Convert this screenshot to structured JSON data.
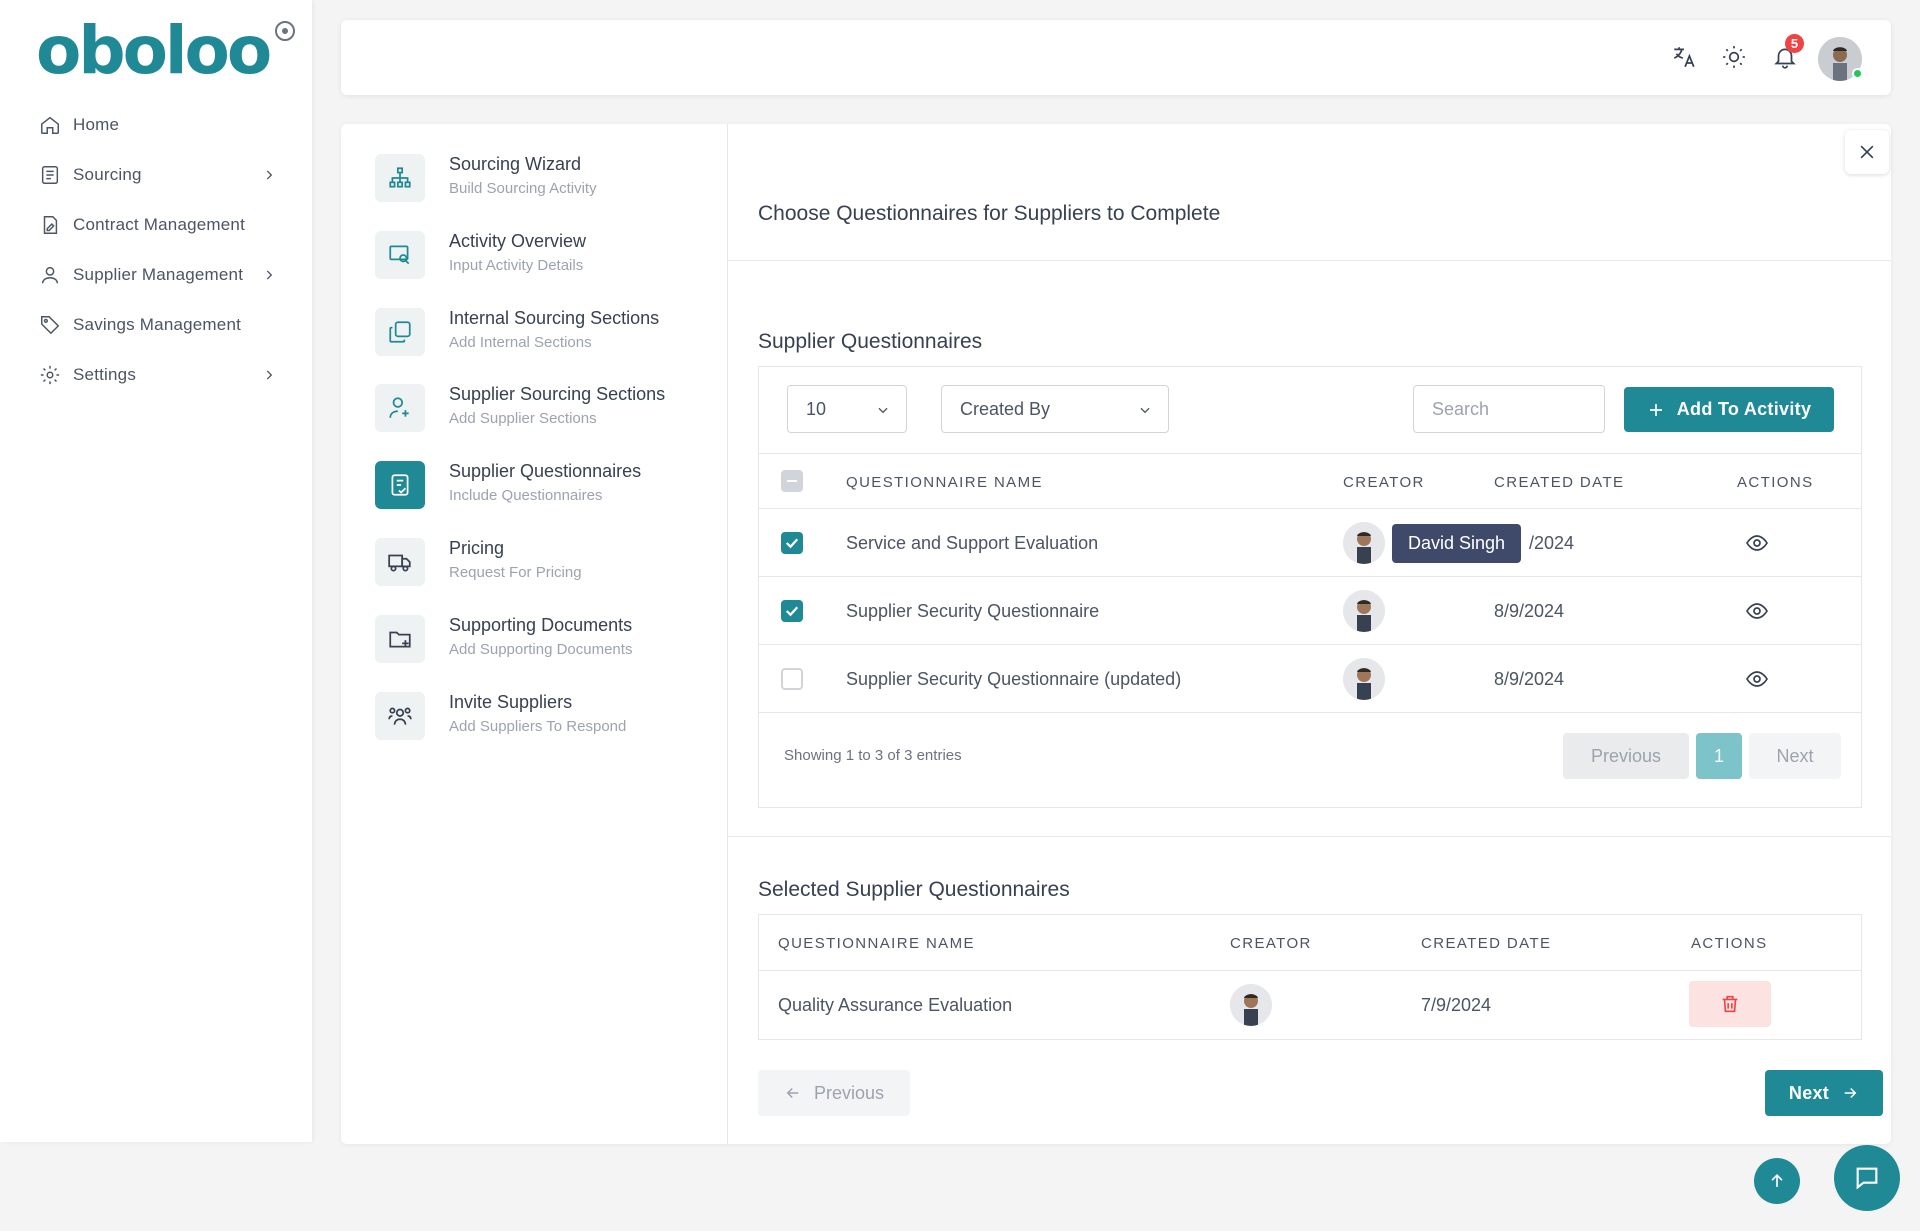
{
  "brand": {
    "logo_text": "oboloo",
    "accent": "#1f8a96"
  },
  "sidebar": {
    "items": [
      {
        "label": "Home",
        "icon": "home-icon"
      },
      {
        "label": "Sourcing",
        "icon": "document-list-icon",
        "has_submenu": true
      },
      {
        "label": "Contract Management",
        "icon": "contract-icon"
      },
      {
        "label": "Supplier Management",
        "icon": "user-icon",
        "has_submenu": true
      },
      {
        "label": "Savings Management",
        "icon": "tag-icon"
      },
      {
        "label": "Settings",
        "icon": "gear-icon",
        "has_submenu": true
      }
    ]
  },
  "header": {
    "notification_count": "5"
  },
  "steps": [
    {
      "title": "Sourcing Wizard",
      "subtitle": "Build Sourcing Activity",
      "icon": "sitemap-icon"
    },
    {
      "title": "Activity Overview",
      "subtitle": "Input Activity Details",
      "icon": "screen-search-icon"
    },
    {
      "title": "Internal Sourcing Sections",
      "subtitle": "Add Internal Sections",
      "icon": "copy-icon"
    },
    {
      "title": "Supplier Sourcing Sections",
      "subtitle": "Add Supplier Sections",
      "icon": "user-plus-icon"
    },
    {
      "title": "Supplier Questionnaires",
      "subtitle": "Include Questionnaires",
      "icon": "checklist-icon",
      "active": true
    },
    {
      "title": "Pricing",
      "subtitle": "Request For Pricing",
      "icon": "truck-icon"
    },
    {
      "title": "Supporting Documents",
      "subtitle": "Add Supporting Documents",
      "icon": "folder-plus-icon"
    },
    {
      "title": "Invite Suppliers",
      "subtitle": "Add Suppliers To Respond",
      "icon": "users-icon"
    }
  ],
  "main": {
    "title": "Choose Questionnaires for Suppliers to Complete",
    "supplier_questionnaires": {
      "title": "Supplier Questionnaires",
      "page_size": "10",
      "creator_filter": "Created By",
      "search_placeholder": "Search",
      "add_button": "Add To Activity",
      "columns": [
        "QUESTIONNAIRE NAME",
        "CREATOR",
        "CREATED DATE",
        "ACTIONS"
      ],
      "rows": [
        {
          "name": "Service and Support Evaluation",
          "date": "/2024",
          "checked": true
        },
        {
          "name": "Supplier Security Questionnaire",
          "date": "8/9/2024",
          "checked": true
        },
        {
          "name": "Supplier Security Questionnaire (updated)",
          "date": "8/9/2024",
          "checked": false
        }
      ],
      "tooltip": "David Singh",
      "showing": "Showing 1 to 3 of 3 entries",
      "pagination": {
        "previous": "Previous",
        "current": "1",
        "next": "Next"
      }
    },
    "selected": {
      "title": "Selected Supplier Questionnaires",
      "columns": [
        "QUESTIONNAIRE NAME",
        "CREATOR",
        "CREATED DATE",
        "ACTIONS"
      ],
      "rows": [
        {
          "name": "Quality Assurance Evaluation",
          "date": "7/9/2024"
        }
      ]
    },
    "footer": {
      "previous": "Previous",
      "next": "Next"
    }
  }
}
